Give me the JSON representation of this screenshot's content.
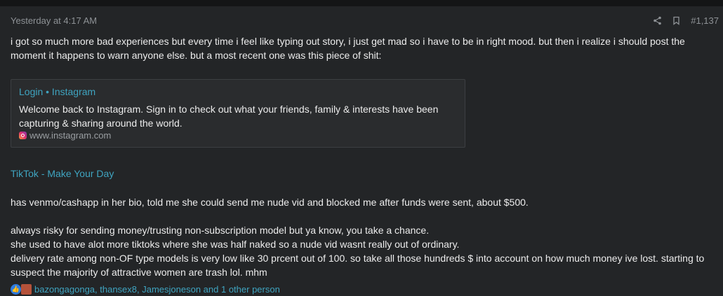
{
  "post": {
    "date": "Yesterday at 4:17 AM",
    "post_number": "#1,137",
    "paragraph1": "i got so much more bad experiences but every time i feel like typing out story, i just get mad so i have to be in right mood. but then i realize i should post the moment it happens to warn anyone else. but a most recent one was this piece of shit:",
    "embed": {
      "title": "Login • Instagram",
      "description": "Welcome back to Instagram. Sign in to check out what your friends, family & interests have been capturing & sharing around the world.",
      "domain": "www.instagram.com",
      "icon": "instagram-icon"
    },
    "tiktok_link": "TikTok - Make Your Day",
    "paragraph2": "has venmo/cashapp in her bio, told me she could send me nude vid and blocked me after funds were sent, about $500.",
    "paragraph3": "always risky for sending money/trusting non-subscription model but ya know, you take a chance.",
    "paragraph4": "she used to have alot more tiktoks where she was half naked so a nude vid wasnt really out of ordinary.",
    "paragraph5": "delivery rate among non-OF type models is very low like 30 prcent out of 100. so take all those hundreds $ into account on how much money ive lost. starting to suspect the majority of attractive women are trash lol. mhm",
    "reactions": "bazongagonga, thansex8, Jamesjoneson and 1 other person"
  },
  "colors": {
    "background": "#232527",
    "link": "#3fa4c0",
    "text": "#ececec",
    "muted": "#8e9296"
  }
}
